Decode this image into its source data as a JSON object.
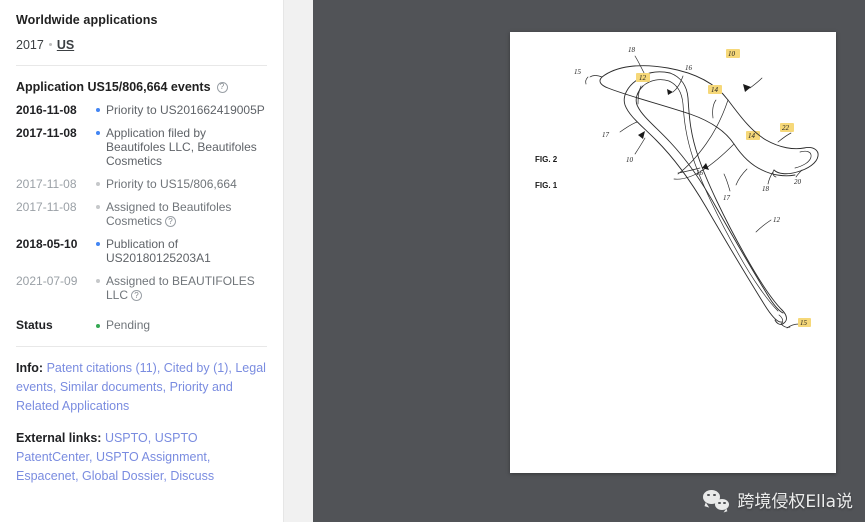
{
  "sidebar": {
    "worldwide": {
      "title": "Worldwide applications",
      "year": "2017",
      "country": "US",
      "separator": "·"
    },
    "application": {
      "title": "Application US15/806,664 events",
      "help_icon": "help-circle-icon"
    },
    "events": [
      {
        "date": "2016-11-08",
        "text": "Priority to US201662419005P",
        "important": true,
        "help": false
      },
      {
        "date": "2017-11-08",
        "text": "Application filed by Beautifoles LLC, Beautifoles Cosmetics",
        "important": true,
        "help": false
      },
      {
        "date": "2017-11-08",
        "text": "Priority to US15/806,664",
        "important": false,
        "help": false
      },
      {
        "date": "2017-11-08",
        "text": "Assigned to Beautifoles Cosmetics",
        "important": false,
        "help": true
      },
      {
        "date": "2018-05-10",
        "text": "Publication of US20180125203A1",
        "important": true,
        "help": false
      },
      {
        "date": "2021-07-09",
        "text": "Assigned to BEAUTIFOLES LLC",
        "important": false,
        "help": true
      }
    ],
    "status": {
      "label": "Status",
      "value": "Pending",
      "color": "#34a853"
    },
    "info": {
      "label": "Info:",
      "links": [
        "Patent citations (11)",
        "Cited by (1)",
        "Legal events",
        "Similar documents",
        "Priority and Related Applications"
      ]
    },
    "external": {
      "label": "External links:",
      "links": [
        "USPTO",
        "USPTO PatentCenter",
        "USPTO Assignment",
        "Espacenet",
        "Global Dossier",
        "Discuss"
      ]
    }
  },
  "viewer": {
    "background_color": "#515357",
    "figures": [
      {
        "label": "FIG. 1",
        "numerals": [
          {
            "text": "18",
            "highlight": false
          },
          {
            "text": "16",
            "highlight": false
          },
          {
            "text": "10",
            "highlight": true
          },
          {
            "text": "17",
            "highlight": false
          },
          {
            "text": "14",
            "highlight": true
          },
          {
            "text": "12",
            "highlight": false
          },
          {
            "text": "15",
            "highlight": true
          }
        ]
      },
      {
        "label": "FIG. 2",
        "numerals": [
          {
            "text": "15",
            "highlight": false
          },
          {
            "text": "12",
            "highlight": true
          },
          {
            "text": "14",
            "highlight": true
          },
          {
            "text": "22",
            "highlight": true
          },
          {
            "text": "10",
            "highlight": false
          },
          {
            "text": "16",
            "highlight": false
          },
          {
            "text": "17",
            "highlight": false
          },
          {
            "text": "18",
            "highlight": false
          },
          {
            "text": "20",
            "highlight": false
          }
        ]
      }
    ]
  },
  "watermark": {
    "text": "跨境侵权Ella说",
    "icon": "wechat-icon"
  }
}
